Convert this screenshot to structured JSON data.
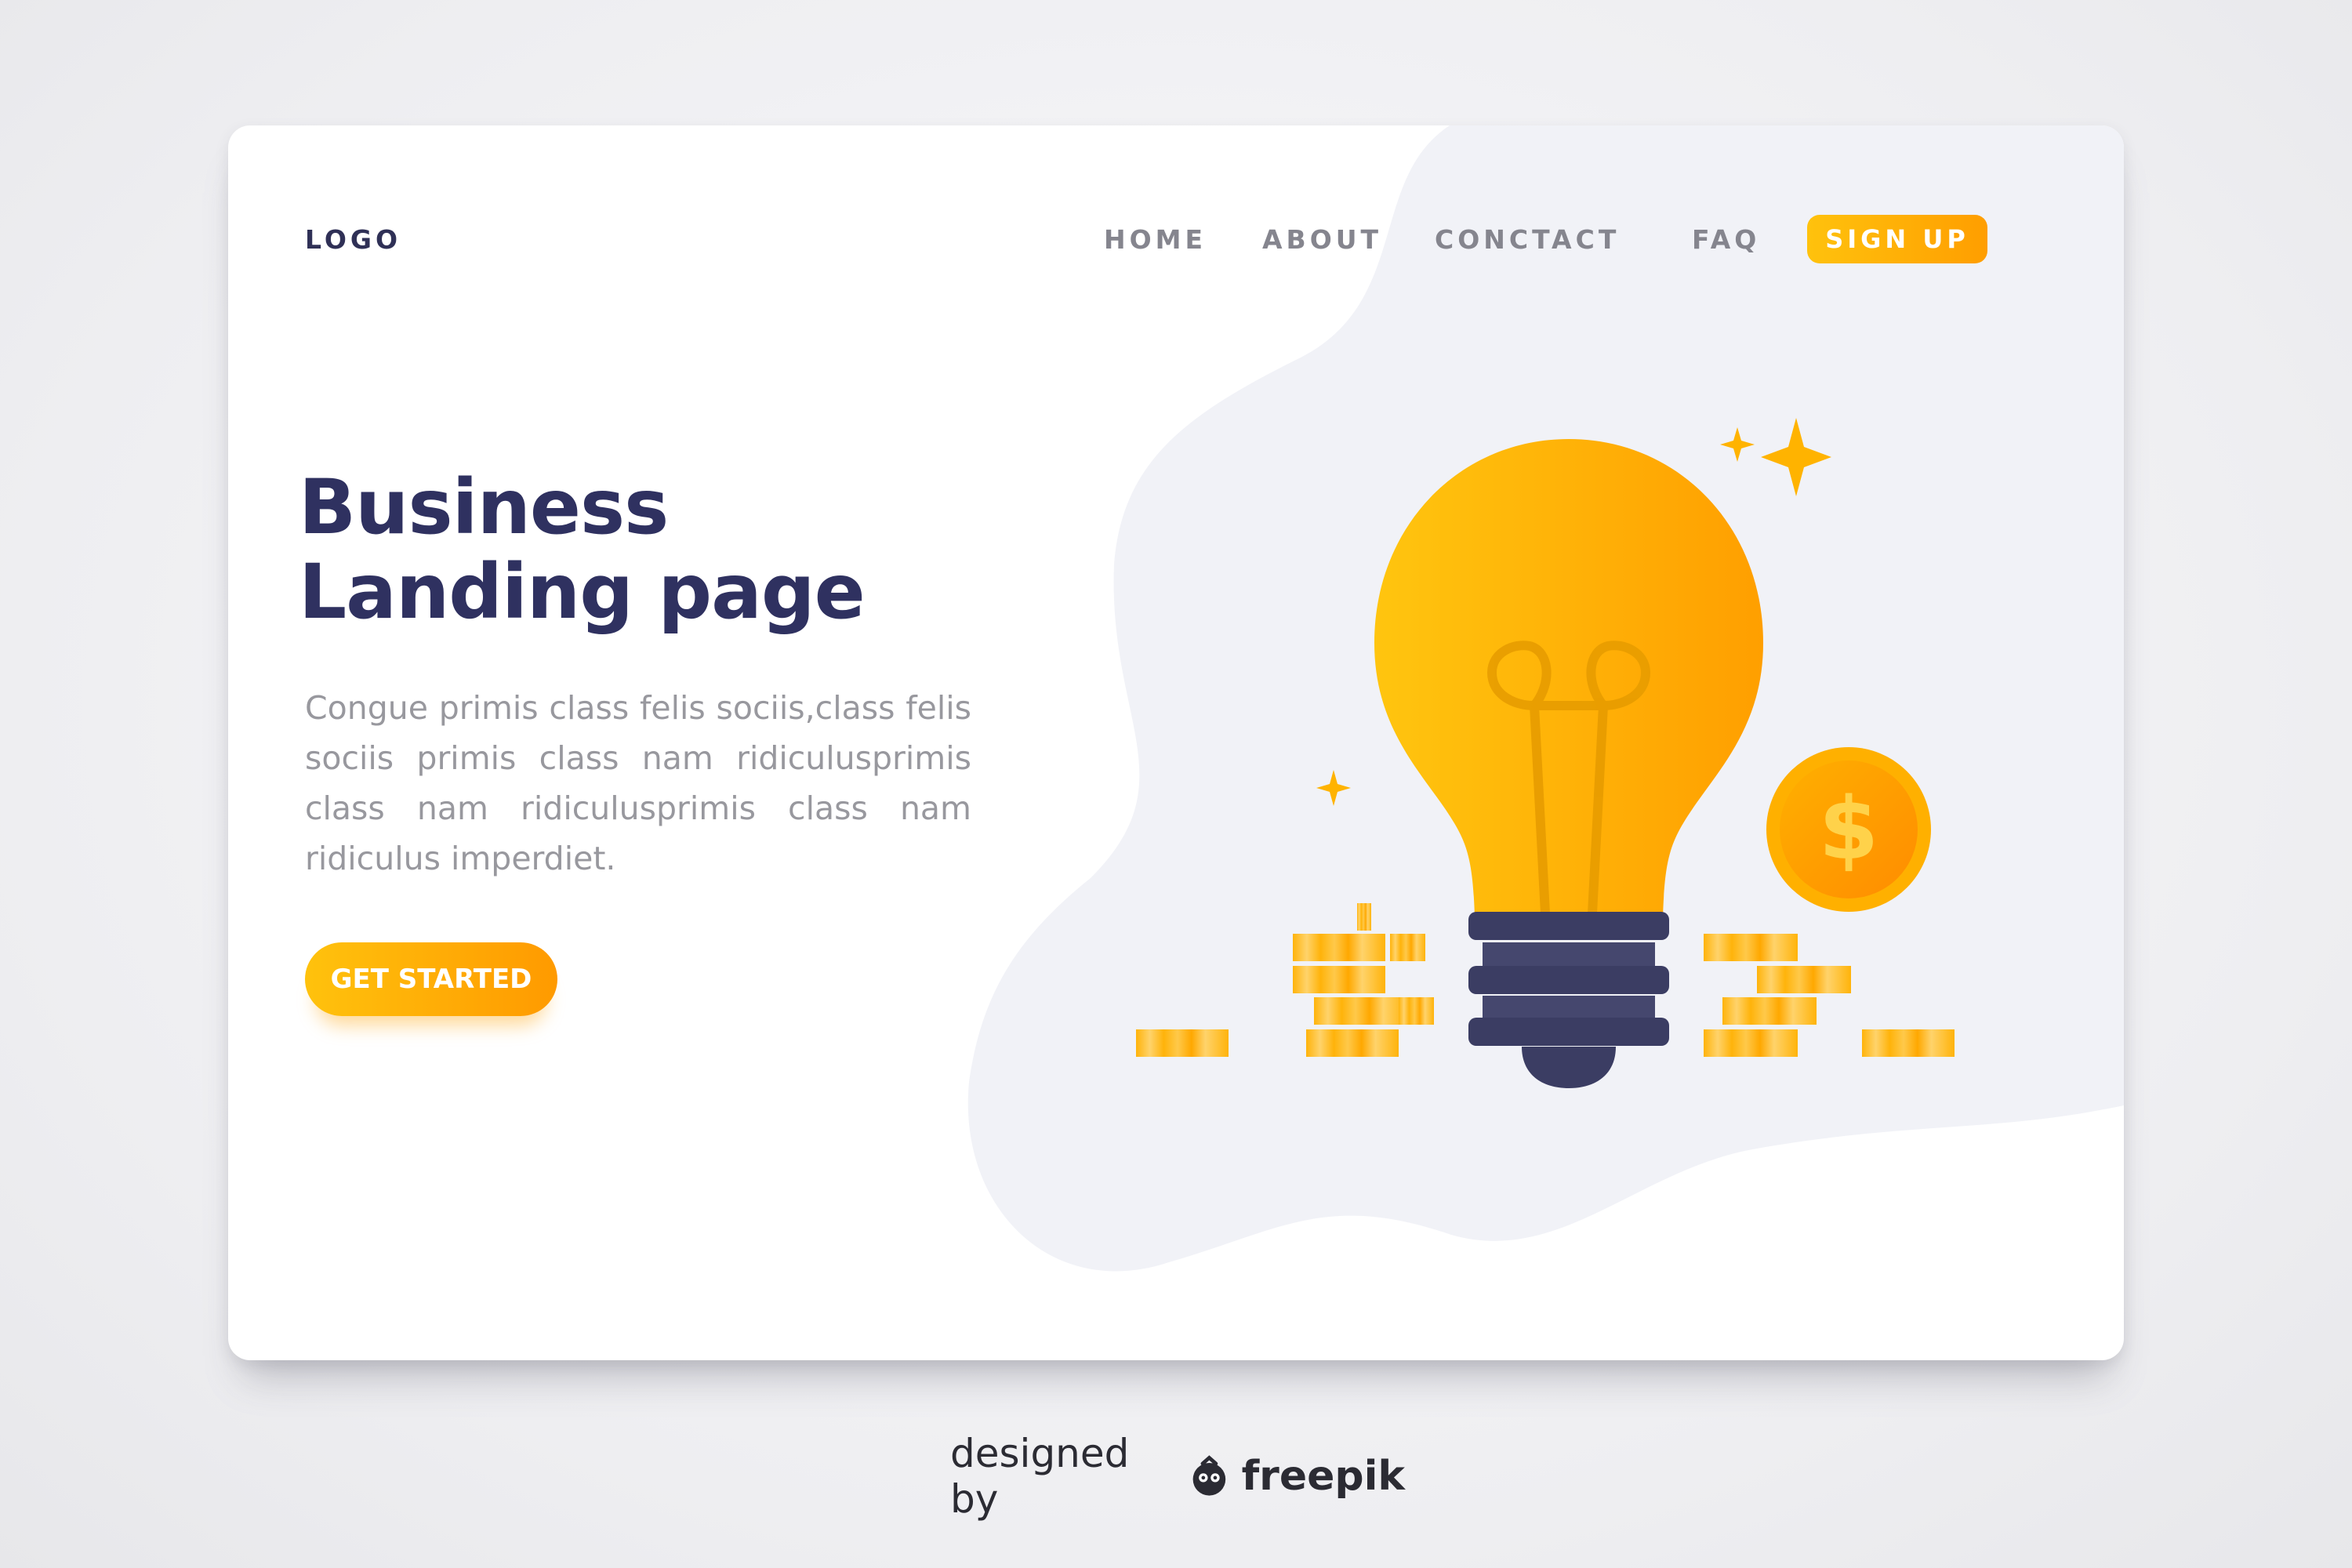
{
  "nav": {
    "logo": "LOGO",
    "items": [
      "HOME",
      "ABOUT",
      "CONCTACT",
      "FAQ"
    ],
    "signup_label": "SIGN UP"
  },
  "hero": {
    "title_line1": "Business",
    "title_line2": "Landing page",
    "body": "Congue primis class felis sociis,class felis sociis primis class nam ridiculusprimis class nam ridiculusprimis class nam ridiculus imperdiet.",
    "cta_label": "GET STARTED"
  },
  "illustration": {
    "subject": "lightbulb-with-coins",
    "coin_symbol": "$"
  },
  "footer": {
    "lead": "designed by",
    "brand": "freepik"
  },
  "colors": {
    "accent": "#ffb400",
    "accent_dark": "#ff9a00",
    "navy": "#2f3160",
    "nav_gray": "#85858e",
    "blob": "#f1f2f7",
    "bulb_base": "#3b3d63"
  }
}
